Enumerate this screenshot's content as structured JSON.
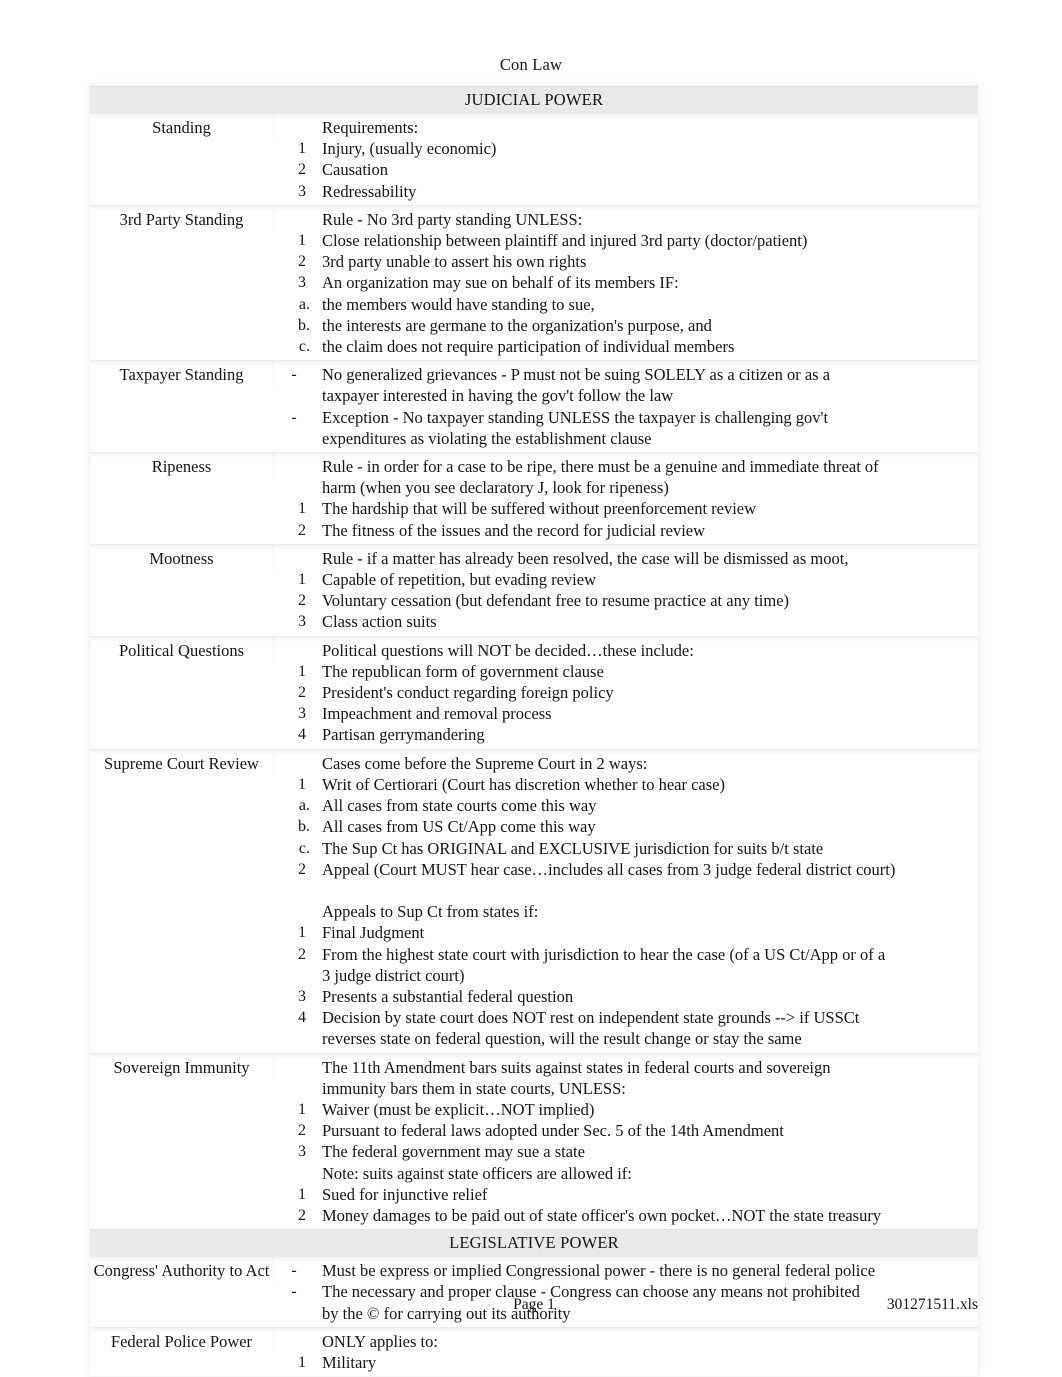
{
  "document": {
    "running_head": "Con Law",
    "footer": {
      "page_label": "Page 1",
      "file_name": "301271511.xls"
    }
  },
  "sections": [
    {
      "band_title": "JUDICIAL POWER",
      "groups": [
        {
          "label": "Standing",
          "rows": [
            {
              "marker": "",
              "text": "Requirements:"
            },
            {
              "marker": "1",
              "text": "Injury, (usually economic)"
            },
            {
              "marker": "2",
              "text": "Causation"
            },
            {
              "marker": "3",
              "text": "Redressability"
            }
          ]
        },
        {
          "label": "3rd Party Standing",
          "rows": [
            {
              "marker": "",
              "text": "Rule - No 3rd party standing UNLESS:"
            },
            {
              "marker": "1",
              "text": "Close relationship between plaintiff and injured 3rd party (doctor/patient)"
            },
            {
              "marker": "2",
              "text": "3rd party unable to assert his own rights"
            },
            {
              "marker": "3",
              "text": "An organization may sue on behalf of its members IF:"
            },
            {
              "marker": "a.",
              "text": "the members would have standing to sue,"
            },
            {
              "marker": "b.",
              "text": "the interests are germane to the organization's purpose, and"
            },
            {
              "marker": "c.",
              "text": "the claim does not require participation of individual members"
            }
          ]
        },
        {
          "label": "Taxpayer Standing",
          "rows": [
            {
              "marker": "-",
              "text": "No generalized grievances - P must not be suing SOLELY as a citizen or as a",
              "text2": "taxpayer interested in having the gov't follow the law"
            },
            {
              "marker": "-",
              "text": "Exception - No taxpayer standing UNLESS the taxpayer is challenging gov't",
              "text2": "expenditures as violating the establishment clause"
            }
          ]
        },
        {
          "label": "Ripeness",
          "rows": [
            {
              "marker": "",
              "text": "Rule - in order for a case to be ripe, there must be a genuine and immediate threat of",
              "text2": "harm (when you see declaratory J, look for ripeness)"
            },
            {
              "marker": "1",
              "text": "The hardship that will be suffered without preenforcement review"
            },
            {
              "marker": "2",
              "text": "The fitness of the issues and the record for judicial review"
            }
          ]
        },
        {
          "label": "Mootness",
          "rows": [
            {
              "marker": "",
              "text": "Rule - if a matter has already been resolved, the case will be dismissed as moot,"
            },
            {
              "marker": "1",
              "text": "Capable of repetition, but evading review"
            },
            {
              "marker": "2",
              "text": "Voluntary cessation (but defendant free to resume practice at any time)"
            },
            {
              "marker": "3",
              "text": "Class action suits"
            }
          ]
        },
        {
          "label": "Political Questions",
          "rows": [
            {
              "marker": "",
              "text": "Political questions will NOT be decided…these include:"
            },
            {
              "marker": "1",
              "text": "The republican form of government clause"
            },
            {
              "marker": "2",
              "text": "President's conduct regarding foreign policy"
            },
            {
              "marker": "3",
              "text": "Impeachment and removal process"
            },
            {
              "marker": "4",
              "text": "Partisan gerrymandering"
            }
          ]
        },
        {
          "label": "Supreme Court Review",
          "rows": [
            {
              "marker": "",
              "text": "Cases come before the Supreme Court in 2 ways:"
            },
            {
              "marker": "1",
              "text": "Writ of Certiorari (Court has discretion whether to hear case)"
            },
            {
              "marker": "a.",
              "text": "All cases from state courts come this way"
            },
            {
              "marker": "b.",
              "text": "All cases from US Ct/App come this way"
            },
            {
              "marker": "c.",
              "text": "The Sup Ct has ORIGINAL and EXCLUSIVE jurisdiction for suits b/t state"
            },
            {
              "marker": "2",
              "text": "Appeal (Court MUST hear case…includes all cases from 3 judge federal district court)"
            },
            {
              "marker": "",
              "text": "",
              "spacer": true
            },
            {
              "marker": "",
              "text": "Appeals to Sup Ct from states if:"
            },
            {
              "marker": "1",
              "text": "Final Judgment"
            },
            {
              "marker": "2",
              "text": "From the highest state court with jurisdiction to hear the case (of a US Ct/App or of a",
              "text2": "3 judge district court)"
            },
            {
              "marker": "3",
              "text": "Presents a substantial federal question"
            },
            {
              "marker": "4",
              "text": "Decision by state court does NOT rest on independent state grounds --> if USSCt",
              "text2": "reverses state on federal question, will the result change or stay the same"
            }
          ]
        },
        {
          "label": "Sovereign Immunity",
          "rows": [
            {
              "marker": "",
              "text": "The 11th Amendment bars suits against states in federal courts and sovereign",
              "text2": "immunity bars them in state courts, UNLESS:"
            },
            {
              "marker": "1",
              "text": "Waiver (must be explicit…NOT implied)"
            },
            {
              "marker": "2",
              "text": "Pursuant to federal laws adopted under Sec. 5 of the 14th Amendment"
            },
            {
              "marker": "3",
              "text": "The federal government may sue a state"
            },
            {
              "marker": "",
              "text": "Note:   suits against state officers are allowed if:"
            },
            {
              "marker": "1",
              "text": "Sued for injunctive relief"
            },
            {
              "marker": "2",
              "text": "Money damages to be paid out of state officer's own pocket…NOT the state treasury"
            }
          ]
        }
      ]
    },
    {
      "band_title": "LEGISLATIVE POWER",
      "groups": [
        {
          "label": "Congress' Authority to Act",
          "rows": [
            {
              "marker": "-",
              "text": "Must be express or implied Congressional power - there is no general federal police"
            },
            {
              "marker": "-",
              "text": "The necessary and proper clause - Congress can choose any means not prohibited",
              "text2": "by the © for carrying out its authority"
            }
          ]
        },
        {
          "label": "Federal Police Power",
          "rows": [
            {
              "marker": "",
              "text": "ONLY applies to:"
            },
            {
              "marker": "1",
              "text": "Military"
            }
          ]
        }
      ]
    }
  ]
}
